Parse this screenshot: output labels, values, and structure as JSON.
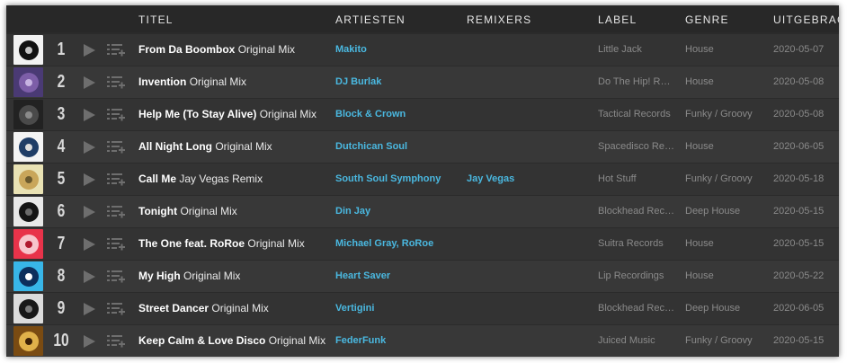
{
  "headers": {
    "title": "TITEL",
    "artists": "ARTIESTEN",
    "remixers": "REMIXERS",
    "label": "LABEL",
    "genre": "GENRE",
    "released": "UITGEBRACHT"
  },
  "tracks": [
    {
      "num": "1",
      "title": "From Da Boombox",
      "mix": "Original Mix",
      "artist": "Makito",
      "remixer": "",
      "label": "Little Jack",
      "genre": "House",
      "date": "2020-05-07",
      "art_colors": [
        "#f2f2f2",
        "#111111",
        "#c4c4c4"
      ]
    },
    {
      "num": "2",
      "title": "Invention",
      "mix": "Original Mix",
      "artist": "DJ Burlak",
      "remixer": "",
      "label": "Do The Hip! Records",
      "genre": "House",
      "date": "2020-05-08",
      "art_colors": [
        "#4a3a74",
        "#7d5ea8",
        "#c7b3e2"
      ]
    },
    {
      "num": "3",
      "title": "Help Me (To Stay Alive)",
      "mix": "Original Mix",
      "artist": "Block & Crown",
      "remixer": "",
      "label": "Tactical Records",
      "genre": "Funky / Groovy",
      "date": "2020-05-08",
      "art_colors": [
        "#222222",
        "#4a4a4a",
        "#8a8a8a"
      ]
    },
    {
      "num": "4",
      "title": "All Night Long",
      "mix": "Original Mix",
      "artist": "Dutchican Soul",
      "remixer": "",
      "label": "Spacedisco Records",
      "genre": "House",
      "date": "2020-06-05",
      "art_colors": [
        "#f4f4f4",
        "#1f3d66",
        "#dddddd"
      ]
    },
    {
      "num": "5",
      "title": "Call Me",
      "mix": "Jay Vegas Remix",
      "artist": "South Soul Symphony",
      "remixer": "Jay Vegas",
      "label": "Hot Stuff",
      "genre": "Funky / Groovy",
      "date": "2020-05-18",
      "art_colors": [
        "#e9e2b4",
        "#c9a65a",
        "#6b5a2e"
      ]
    },
    {
      "num": "6",
      "title": "Tonight",
      "mix": "Original Mix",
      "artist": "Din Jay",
      "remixer": "",
      "label": "Blockhead Recordings",
      "genre": "Deep House",
      "date": "2020-05-15",
      "art_colors": [
        "#e8e8e8",
        "#141414",
        "#6a6a6a"
      ]
    },
    {
      "num": "7",
      "title": "The One feat. RoRoe",
      "mix": "Original Mix",
      "artist": "Michael Gray, RoRoe",
      "remixer": "",
      "label": "Suitra Records",
      "genre": "House",
      "date": "2020-05-15",
      "art_colors": [
        "#e8334a",
        "#f7c5cc",
        "#b0182e"
      ]
    },
    {
      "num": "8",
      "title": "My High",
      "mix": "Original Mix",
      "artist": "Heart Saver",
      "remixer": "",
      "label": "Lip Recordings",
      "genre": "House",
      "date": "2020-05-22",
      "art_colors": [
        "#38b6e8",
        "#0d2f5c",
        "#ffffff"
      ]
    },
    {
      "num": "9",
      "title": "Street Dancer",
      "mix": "Original Mix",
      "artist": "Vertigini",
      "remixer": "",
      "label": "Blockhead Recordings",
      "genre": "Deep House",
      "date": "2020-06-05",
      "art_colors": [
        "#dcdcdc",
        "#181818",
        "#7a7a7a"
      ]
    },
    {
      "num": "10",
      "title": "Keep Calm & Love Disco",
      "mix": "Original Mix",
      "artist": "FederFunk",
      "remixer": "",
      "label": "Juiced Music",
      "genre": "Funky / Groovy",
      "date": "2020-05-15",
      "art_colors": [
        "#7a4b12",
        "#e0b14a",
        "#3a1f06"
      ]
    }
  ]
}
